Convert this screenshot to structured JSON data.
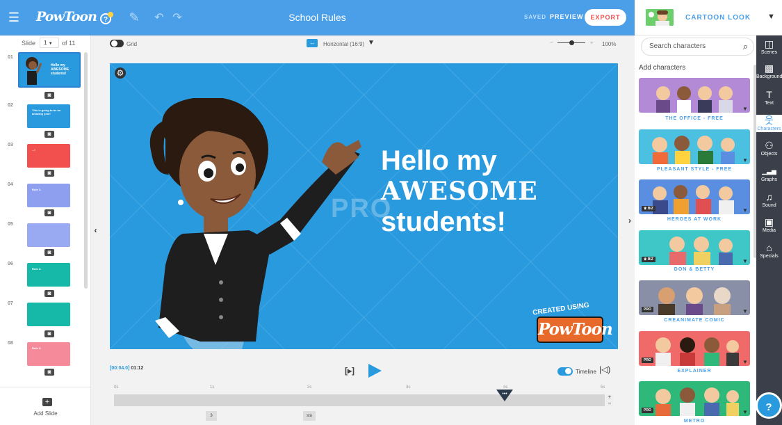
{
  "topbar": {
    "logo": "PowToon",
    "title": "School Rules",
    "saved": "SAVED",
    "preview": "PREVIEW",
    "export": "EXPORT"
  },
  "style_selector": {
    "label": "CARTOON LOOK"
  },
  "slides": {
    "label": "Slide",
    "current": "1",
    "of": "of 11",
    "items": [
      {
        "num": "01",
        "text": "Hello my AWESOME students!",
        "color": "#2a9ade"
      },
      {
        "num": "02",
        "text": "This is going to be an amazing year!",
        "color": "#2a9ade"
      },
      {
        "num": "03",
        "text": "...!",
        "color": "#f24f4f"
      },
      {
        "num": "04",
        "text": "Rule 1:",
        "color": "#8f9ff0"
      },
      {
        "num": "05",
        "text": "",
        "color": "#9aaaf2"
      },
      {
        "num": "06",
        "text": "Rule 2:",
        "color": "#16b8a8"
      },
      {
        "num": "07",
        "text": "",
        "color": "#16b8a8"
      },
      {
        "num": "08",
        "text": "Rule 3:",
        "color": "#f58a9a"
      }
    ],
    "add_label": "Add Slide"
  },
  "canvas_toolbar": {
    "grid": "Grid",
    "orientation": "Horizontal (16:9)",
    "zoom": "100%",
    "zoom_level": 0.5
  },
  "slide_content": {
    "line1": "Hello my",
    "line2": "AWESOME",
    "line3": "students!",
    "watermark": "PRO",
    "created_using": "CREATED USING",
    "brand": "PowToon"
  },
  "timeline": {
    "current": "[00:04.0]",
    "duration": "01:12",
    "play_bracket": "[▸]",
    "toggle_label": "Timeline",
    "ticks": [
      "0s",
      "1s",
      "2s",
      "3s",
      "4s",
      "5s"
    ],
    "markers": [
      "3",
      "stu"
    ]
  },
  "characters": {
    "search_placeholder": "Search characters",
    "heading": "Add characters",
    "sets": [
      {
        "label": "THE OFFICE - FREE",
        "badge": "",
        "bg": "#b38ad6"
      },
      {
        "label": "PLEASANT STYLE - FREE",
        "badge": "",
        "bg": "#4cc0e0"
      },
      {
        "label": "HEROES AT WORK",
        "badge": "♛ BIZ",
        "bg": "#5a8ee0"
      },
      {
        "label": "DON & BETTY",
        "badge": "♛ BIZ",
        "bg": "#3fc6c6"
      },
      {
        "label": "CREANIMATE COMIC",
        "badge": "PRO",
        "bg": "#8a8fa8"
      },
      {
        "label": "EXPLAINER",
        "badge": "PRO",
        "bg": "#f06a6a"
      },
      {
        "label": "METRO",
        "badge": "PRO",
        "bg": "#2eb87a"
      }
    ]
  },
  "rail": [
    {
      "icon": "◫",
      "label": "Scenes"
    },
    {
      "icon": "▩",
      "label": "Background"
    },
    {
      "icon": "T",
      "label": "Text"
    },
    {
      "icon": "웃",
      "label": "Characters"
    },
    {
      "icon": "⚇",
      "label": "Objects"
    },
    {
      "icon": "▁▃▅",
      "label": "Graphs"
    },
    {
      "icon": "♫",
      "label": "Sound"
    },
    {
      "icon": "▣",
      "label": "Media"
    },
    {
      "icon": "⌂",
      "label": "Specials"
    }
  ],
  "help": "?"
}
